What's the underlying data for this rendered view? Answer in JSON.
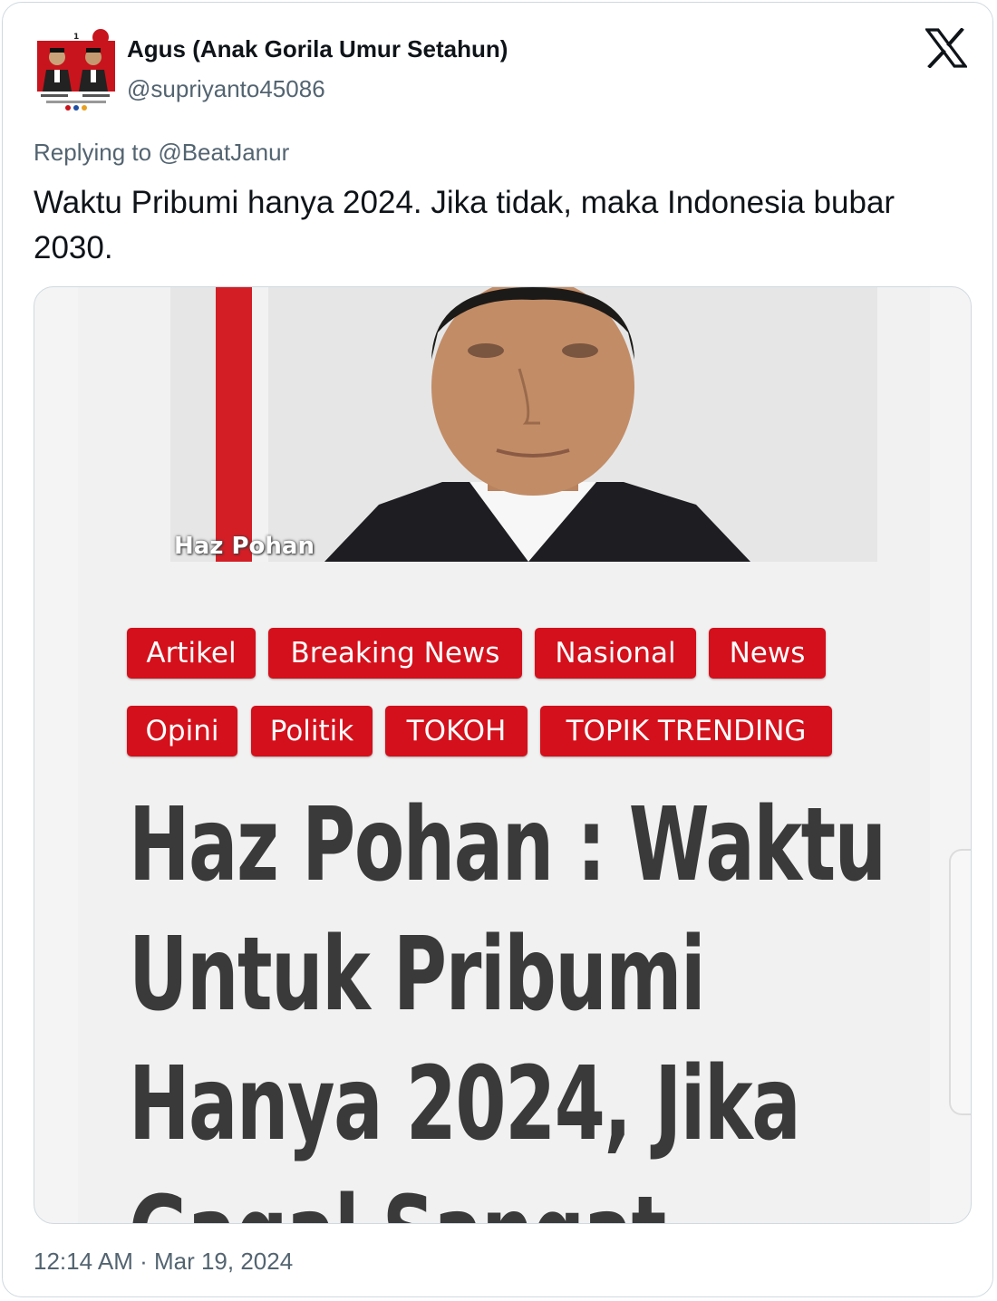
{
  "author": {
    "display_name": "Agus (Anak Gorila Umur Setahun)",
    "handle": "@supriyanto45086"
  },
  "reply": {
    "prefix": "Replying to",
    "mention": "@BeatJanur"
  },
  "tweet": {
    "text": "Waktu Pribumi hanya 2024. Jika tidak, maka Indonesia bubar 2030.",
    "timestamp": "12:14 AM · Mar 19, 2024"
  },
  "media": {
    "photo_caption": "Haz Pohan",
    "tags": [
      "Artikel",
      "Breaking News",
      "Nasional",
      "News",
      "Opini",
      "Politik",
      "TOKOH",
      "TOPIK TRENDING"
    ],
    "headline_lines": [
      "Haz Pohan : Waktu",
      "Untuk Pribumi",
      "Hanya 2024, Jika",
      "Gagal Sangat"
    ],
    "tag_color": "#d3101b"
  },
  "icons": {
    "brand": "x-logo-icon",
    "avatar": "avatar-image"
  }
}
